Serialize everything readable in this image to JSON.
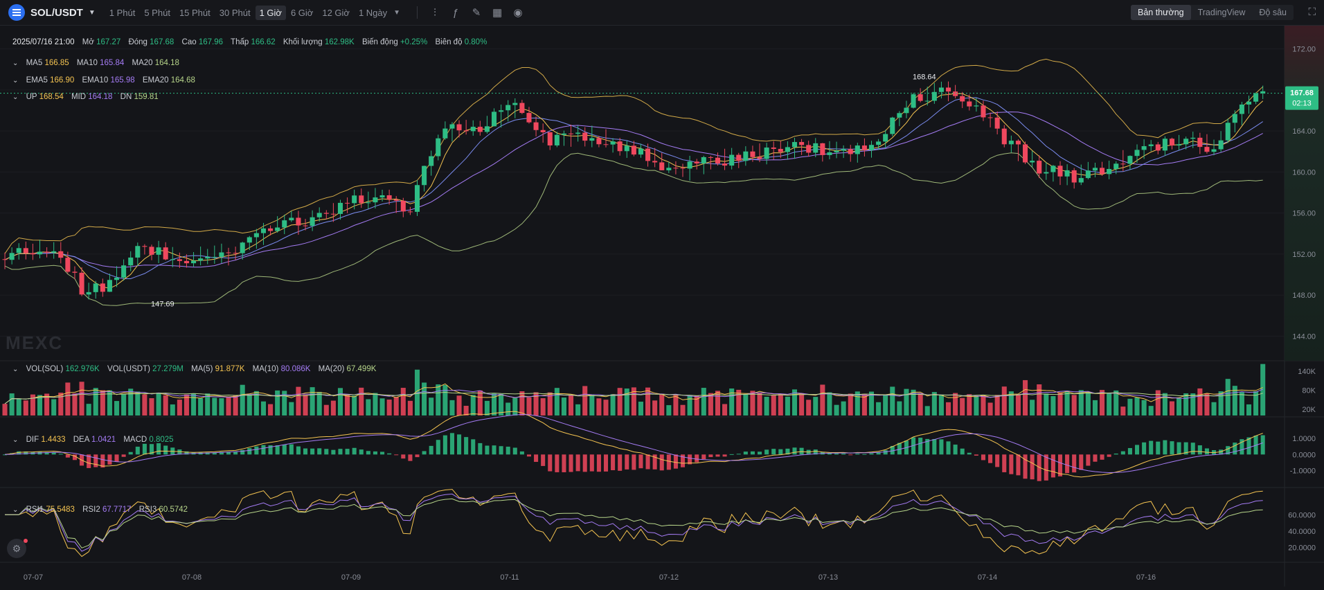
{
  "header": {
    "pair": "SOL/USDT",
    "timeframes": [
      "1 Phút",
      "5 Phút",
      "15 Phút",
      "30 Phút",
      "1 Giờ",
      "6 Giờ",
      "12 Giờ",
      "1 Ngày"
    ],
    "active_timeframe": "1 Giờ",
    "modes": [
      "Bản thường",
      "TradingView",
      "Độ sâu"
    ],
    "active_mode": "Bản thường"
  },
  "icons": [
    "sol-logo-icon",
    "dropdown-caret-icon",
    "candle-type-icon",
    "indicator-icon",
    "draw-icon",
    "layout-icon",
    "camera-icon",
    "fullscreen-icon",
    "settings-icon"
  ],
  "watermark": "MEXC",
  "ohlc": {
    "date": "2025/07/16 21:00",
    "open_label": "Mở",
    "open": "167.27",
    "close_label": "Đóng",
    "close": "167.68",
    "high_label": "Cao",
    "high": "167.96",
    "low_label": "Thấp",
    "low": "166.62",
    "volume_label": "Khối lượng",
    "volume": "162.98K",
    "change_label": "Biến động",
    "change": "+0.25%",
    "amp_label": "Biên độ",
    "amp": "0.80%"
  },
  "ma": {
    "ma5_label": "MA5",
    "ma5": "166.85",
    "ma10_label": "MA10",
    "ma10": "165.84",
    "ma20_label": "MA20",
    "ma20": "164.18"
  },
  "ema": {
    "ema5_label": "EMA5",
    "ema5": "166.90",
    "ema10_label": "EMA10",
    "ema10": "165.98",
    "ema20_label": "EMA20",
    "ema20": "164.68"
  },
  "boll": {
    "up_label": "UP",
    "up": "168.54",
    "mid_label": "MID",
    "mid": "164.18",
    "dn_label": "DN",
    "dn": "159.81"
  },
  "vol": {
    "sol_label": "VOL(SOL)",
    "sol": "162.976K",
    "usdt_label": "VOL(USDT)",
    "usdt": "27.279M",
    "ma5_label": "MA(5)",
    "ma5": "91.877K",
    "ma10_label": "MA(10)",
    "ma10": "80.086K",
    "ma20_label": "MA(20)",
    "ma20": "67.499K"
  },
  "macd": {
    "dif_label": "DIF",
    "dif": "1.4433",
    "dea_label": "DEA",
    "dea": "1.0421",
    "macd_label": "MACD",
    "macd": "0.8025"
  },
  "rsi": {
    "rsi1_label": "RSI1",
    "rsi1": "75.5483",
    "rsi2_label": "RSI2",
    "rsi2": "67.7717",
    "rsi3_label": "RSI3",
    "rsi3": "60.5742"
  },
  "price_axis": {
    "ticks": [
      "172.00",
      "168.00",
      "164.00",
      "160.00",
      "156.00",
      "152.00",
      "148.00",
      "144.00"
    ],
    "current_price": "167.68",
    "countdown": "02:13"
  },
  "price_annotations": {
    "high": "168.64",
    "low": "147.69"
  },
  "volume_axis": {
    "ticks": [
      "140K",
      "80K",
      "20K"
    ]
  },
  "macd_axis": {
    "ticks": [
      "1.0000",
      "0.0000",
      "-1.0000"
    ]
  },
  "rsi_axis": {
    "ticks": [
      "60.0000",
      "40.0000",
      "20.0000"
    ]
  },
  "time_axis": {
    "labels": [
      "07-07",
      "07-08",
      "07-09",
      "07-11",
      "07-12",
      "07-13",
      "07-14",
      "07-16"
    ]
  },
  "colors": {
    "up": "#2ebd85",
    "down": "#f0485e",
    "ma5": "#f5c451",
    "ma10": "#a57cf5",
    "ma20": "#b7d58a",
    "accent": "#2b6ff0"
  }
}
